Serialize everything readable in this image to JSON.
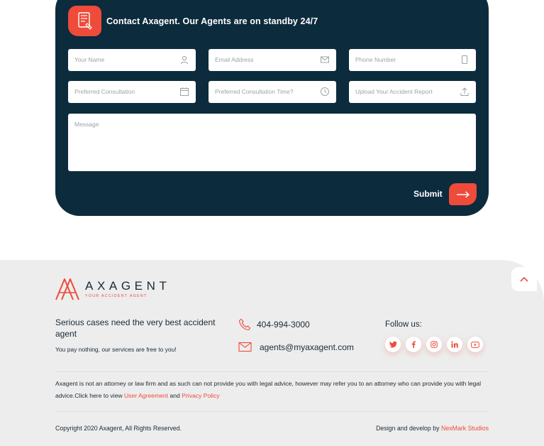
{
  "contact": {
    "title": "Contact Axagent. Our Agents are on standby 24/7",
    "fields": {
      "name": "Your Name",
      "email": "Email Address",
      "phone": "Phone Number",
      "consultation": "Preferred Consultation",
      "consultation_time": "Preferred Consultation Time?",
      "upload": "Upload Your Accident Report",
      "message": "Message"
    },
    "submit_label": "Submit"
  },
  "footer": {
    "logo_name": "AXAGENT",
    "logo_tagline": "YOUR ACCIDENT AGENT",
    "headline": "Serious cases need the very best accident agent",
    "subtext": "You pay nothing, our services are free to you!",
    "phone": "404-994-3000",
    "email": "agents@myaxagent.com",
    "follow_label": "Follow us:",
    "social_icons": [
      "twitter-icon",
      "facebook-icon",
      "instagram-icon",
      "linkedin-icon",
      "youtube-icon"
    ],
    "disclaimer_text": " Axagent is not an attorney or law firm and as such can not provide you with legal advice, however may refer you to an attorney who can provide you with legal advice.Click here to view ",
    "user_agreement": "User Agreement",
    "and": " and ",
    "privacy_policy": "Privacy Policy",
    "copyright": "Copyright 2020 Axagent, All Rights Reserved.",
    "credit_text": "Design and develop  by ",
    "credit_studio": "NexMark Studios"
  },
  "colors": {
    "accent": "#ee4b3b",
    "card_bg": "#0c2b3c",
    "footer_bg": "#ededed"
  }
}
